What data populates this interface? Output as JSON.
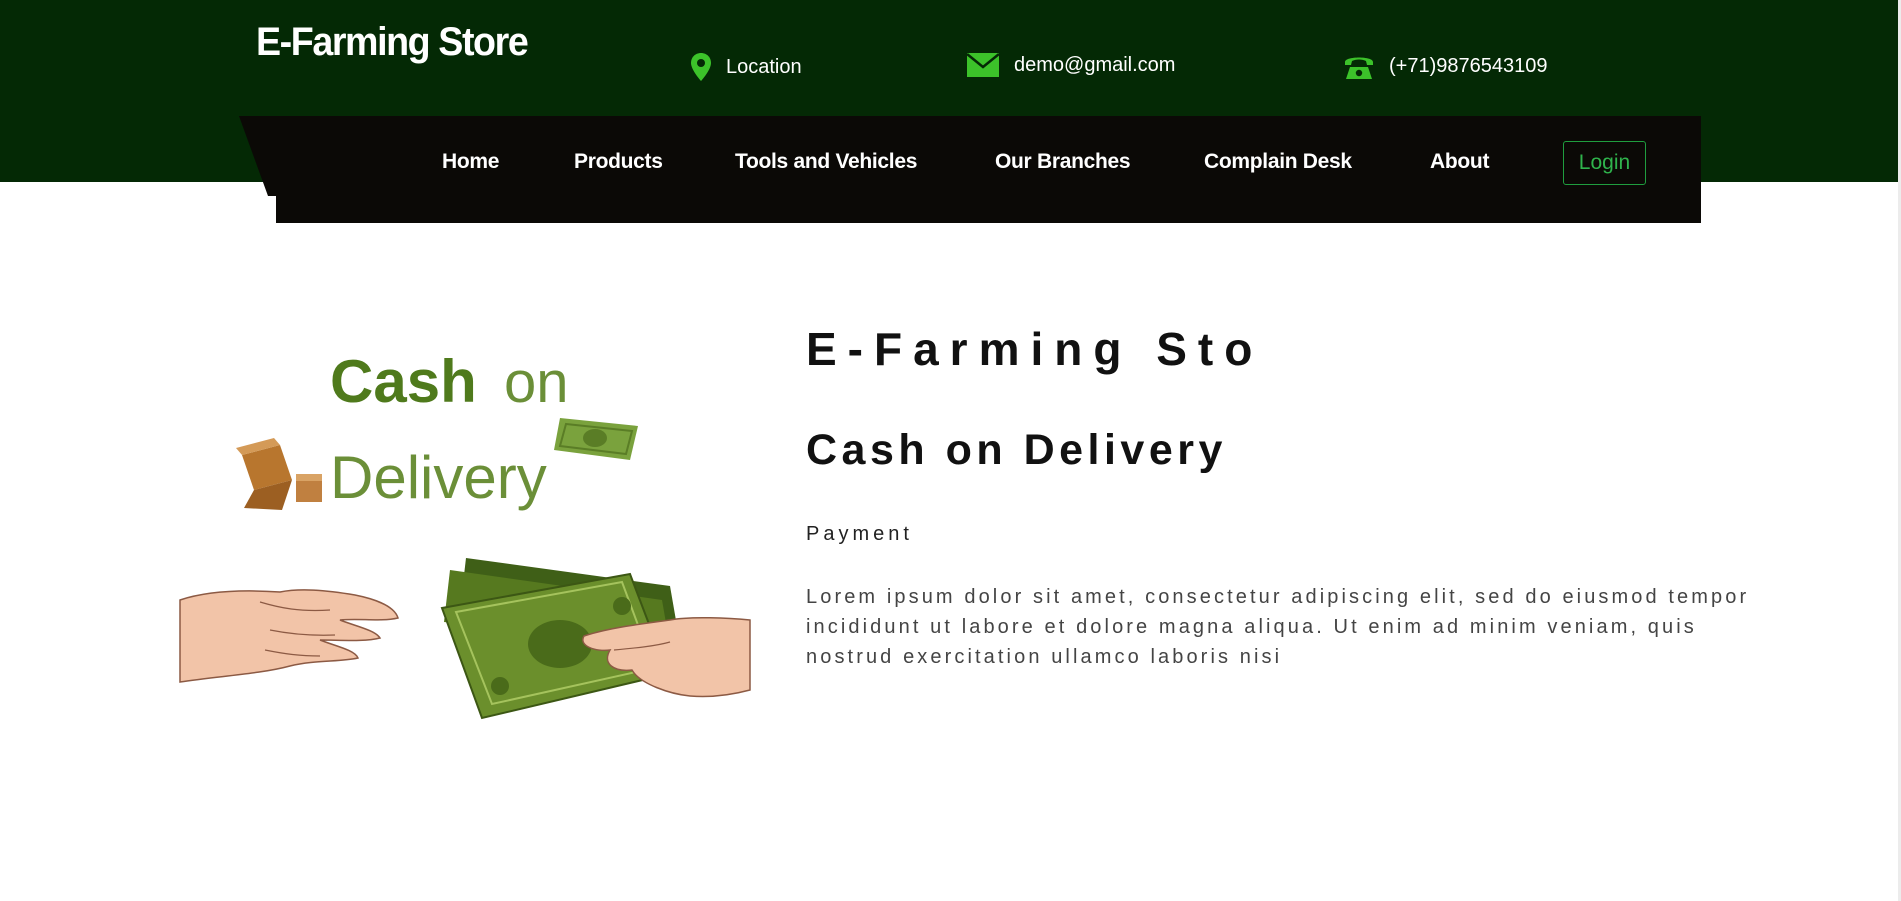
{
  "header": {
    "brand": "E-Farming Store",
    "location": "Location",
    "email": "demo@gmail.com",
    "phone": "(+71)9876543109"
  },
  "nav": {
    "items": [
      "Home",
      "Products",
      "Tools and Vehicles",
      "Our Branches",
      "Complain Desk",
      "About"
    ],
    "login": "Login"
  },
  "main": {
    "store_title": "E-Farming Sto",
    "method_title": "Cash on Delivery",
    "label": "Payment",
    "description": "Lorem ipsum dolor sit amet, consectetur adipiscing elit, sed do eiusmod tempor incididunt ut labore et dolore magna aliqua. Ut enim ad minim veniam, quis nostrud exercitation ullamco laboris nisi",
    "image": {
      "line1_bold": "Cash",
      "line1_light": "on",
      "line2": "Delivery"
    }
  },
  "colors": {
    "header_bg": "#042905",
    "nav_bg": "#0b0906",
    "accent_green": "#2fb34c",
    "icon_green": "#3cc22a"
  },
  "icons": [
    "location-pin-icon",
    "envelope-icon",
    "telephone-icon"
  ]
}
